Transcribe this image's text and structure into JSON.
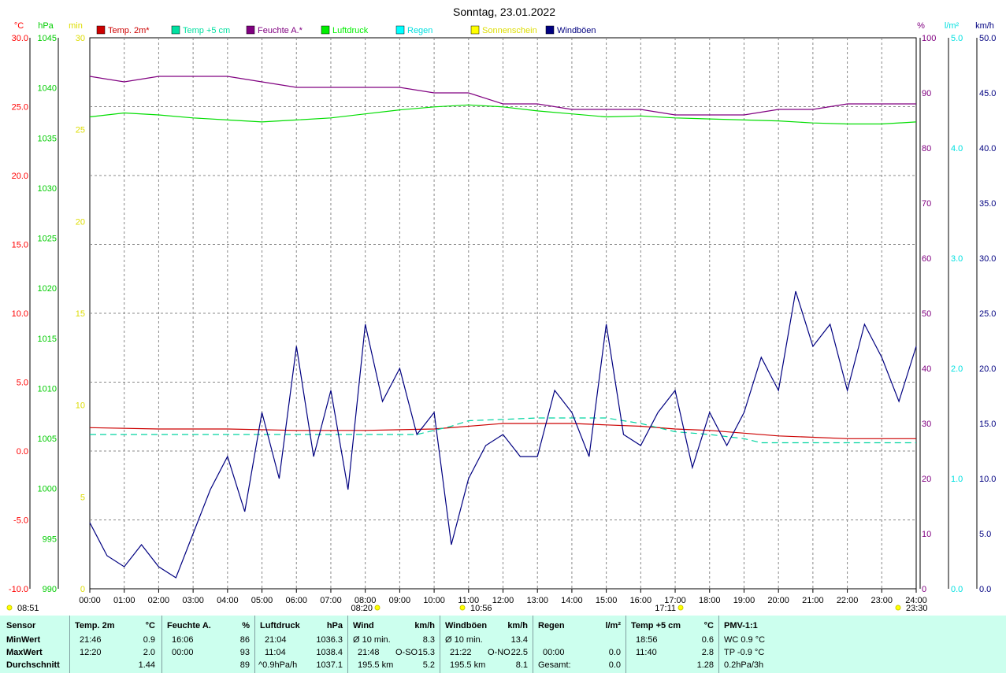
{
  "chart_data": {
    "type": "line",
    "title": "Sonntag, 23.01.2022",
    "x_ticks": [
      "00:00",
      "01:00",
      "02:00",
      "03:00",
      "04:00",
      "05:00",
      "06:00",
      "07:00",
      "08:00",
      "09:00",
      "10:00",
      "11:00",
      "12:00",
      "13:00",
      "14:00",
      "15:00",
      "16:00",
      "17:00",
      "18:00",
      "19:00",
      "20:00",
      "21:00",
      "22:00",
      "23:00",
      "24:00"
    ],
    "axes": {
      "temp": {
        "unit": "°C",
        "color": "#ff0000",
        "min": -10,
        "max": 30,
        "ticks": [
          "30.0",
          "25.0",
          "20.0",
          "15.0",
          "10.0",
          "5.0",
          "0.0",
          "-5.0",
          "-10.0"
        ]
      },
      "pressure": {
        "unit": "hPa",
        "color": "#00cc00",
        "min": 990,
        "max": 1045,
        "ticks": [
          "1045",
          "1040",
          "1035",
          "1030",
          "1025",
          "1020",
          "1015",
          "1010",
          "1005",
          "1000",
          "995",
          "990"
        ]
      },
      "sunshine": {
        "unit": "min",
        "color": "#ffff00",
        "min": 0,
        "max": 30,
        "ticks": [
          "30",
          "25",
          "20",
          "15",
          "10",
          "5",
          "0"
        ]
      },
      "humidity": {
        "unit": "%",
        "color": "#800080",
        "min": 0,
        "max": 100,
        "ticks": [
          "100",
          "90",
          "80",
          "70",
          "60",
          "50",
          "40",
          "30",
          "20",
          "10",
          "0"
        ]
      },
      "rain": {
        "unit": "l/m²",
        "color": "#00e0e0",
        "min": 0,
        "max": 5,
        "ticks": [
          "5.0",
          "4.0",
          "3.0",
          "2.0",
          "1.0",
          "0.0"
        ]
      },
      "wind": {
        "unit": "km/h",
        "color": "#000080",
        "min": 0,
        "max": 50,
        "ticks": [
          "50.0",
          "45.0",
          "40.0",
          "35.0",
          "30.0",
          "25.0",
          "20.0",
          "15.0",
          "10.0",
          "5.0",
          "0.0"
        ]
      }
    },
    "legend": [
      {
        "label": "Temp. 2m*",
        "color": "#cc0000"
      },
      {
        "label": "Temp +5 cm",
        "color": "#00e0a0"
      },
      {
        "label": "Feuchte A.*",
        "color": "#800080"
      },
      {
        "label": "Luftdruck",
        "color": "#00ee00"
      },
      {
        "label": "Regen",
        "color": "#00ffff"
      },
      {
        "label": "Sonnenschein",
        "color": "#ffff00"
      },
      {
        "label": "Windböen",
        "color": "#000080"
      }
    ],
    "series": [
      {
        "name": "Temp. 2m*",
        "axis": "temp",
        "x": [
          0,
          2,
          4,
          6,
          8,
          10,
          12,
          14,
          15,
          16,
          17,
          18,
          19,
          20,
          21,
          22,
          23,
          24
        ],
        "values": [
          1.7,
          1.6,
          1.6,
          1.5,
          1.5,
          1.6,
          2.0,
          2.0,
          1.9,
          1.8,
          1.6,
          1.5,
          1.3,
          1.1,
          1.0,
          0.9,
          0.9,
          0.9
        ]
      },
      {
        "name": "Temp +5 cm",
        "axis": "temp",
        "x": [
          0,
          8,
          9.5,
          10.5,
          11,
          12,
          13,
          15,
          16,
          17,
          18,
          19,
          19.5,
          24
        ],
        "values": [
          1.2,
          1.2,
          1.2,
          1.8,
          2.2,
          2.3,
          2.4,
          2.4,
          2.0,
          1.4,
          1.2,
          0.9,
          0.6,
          0.6
        ]
      },
      {
        "name": "Feuchte A.*",
        "axis": "humidity",
        "x": [
          0,
          1,
          2,
          3,
          4,
          5,
          6,
          7,
          8,
          9,
          10,
          11,
          12,
          13,
          14,
          15,
          16,
          17,
          18,
          19,
          20,
          21,
          22,
          23,
          24
        ],
        "values": [
          93,
          92,
          93,
          93,
          93,
          92,
          91,
          91,
          91,
          91,
          90,
          90,
          88,
          88,
          87,
          87,
          87,
          86,
          86,
          86,
          87,
          87,
          88,
          88,
          88
        ]
      },
      {
        "name": "Luftdruck",
        "axis": "pressure",
        "x": [
          0,
          1,
          2,
          3,
          4,
          5,
          6,
          7,
          8,
          9,
          10,
          11,
          12,
          13,
          14,
          15,
          16,
          17,
          18,
          19,
          20,
          21,
          22,
          23,
          24
        ],
        "values": [
          1037.1,
          1037.5,
          1037.3,
          1037.0,
          1036.8,
          1036.6,
          1036.8,
          1037.0,
          1037.4,
          1037.8,
          1038.1,
          1038.3,
          1038.1,
          1037.7,
          1037.4,
          1037.1,
          1037.2,
          1037.0,
          1036.9,
          1036.8,
          1036.7,
          1036.5,
          1036.4,
          1036.4,
          1036.6
        ]
      },
      {
        "name": "Windböen",
        "axis": "wind",
        "x": [
          0,
          0.5,
          1,
          1.5,
          2,
          2.5,
          3,
          3.5,
          4,
          4.5,
          5,
          5.5,
          6,
          6.5,
          7,
          7.5,
          8,
          8.5,
          9,
          9.5,
          10,
          10.5,
          11,
          11.5,
          12,
          12.5,
          13,
          13.5,
          14,
          14.5,
          15,
          15.5,
          16,
          16.5,
          17,
          17.5,
          18,
          18.5,
          19,
          19.5,
          20,
          20.5,
          21,
          21.5,
          22,
          22.5,
          23,
          23.5,
          24
        ],
        "values": [
          6,
          3,
          2,
          4,
          2,
          1,
          5,
          9,
          12,
          7,
          16,
          10,
          22,
          12,
          18,
          9,
          24,
          17,
          20,
          14,
          16,
          4,
          10,
          13,
          14,
          12,
          12,
          18,
          16,
          12,
          24,
          14,
          13,
          16,
          18,
          11,
          16,
          13,
          16,
          21,
          18,
          27,
          22,
          24,
          18,
          24,
          21,
          17,
          22
        ]
      }
    ],
    "markers": [
      {
        "label": "08:51"
      },
      {
        "label": "08:20"
      },
      {
        "label": "10:56"
      },
      {
        "label": "17:11"
      },
      {
        "label": "23:30"
      }
    ]
  },
  "stats": {
    "sensor": {
      "header": "Sensor",
      "rows": [
        "MinWert",
        "MaxWert",
        "Durchschnitt"
      ]
    },
    "temp2m": {
      "header": "Temp. 2m",
      "unit": "°C",
      "rows": [
        [
          "21:46",
          "0.9"
        ],
        [
          "12:20",
          "2.0"
        ],
        [
          "",
          "1.44"
        ]
      ]
    },
    "feuchte": {
      "header": "Feuchte A.",
      "unit": "%",
      "rows": [
        [
          "16:06",
          "86"
        ],
        [
          "00:00",
          "93"
        ],
        [
          "",
          "89"
        ]
      ]
    },
    "luftdruck": {
      "header": "Luftdruck",
      "unit": "hPa",
      "rows": [
        [
          "21:04",
          "1036.3"
        ],
        [
          "11:04",
          "1038.4"
        ],
        [
          "^0.9hPa/h",
          "1037.1"
        ]
      ]
    },
    "wind": {
      "header": "Wind",
      "unit": "km/h",
      "rows": [
        [
          "Ø 10 min.",
          "",
          "8.3"
        ],
        [
          "21:48",
          "O-SO",
          "15.3"
        ],
        [
          "195.5 km",
          "",
          "5.2"
        ]
      ]
    },
    "windboeen": {
      "header": "Windböen",
      "unit": "km/h",
      "rows": [
        [
          "Ø 10 min.",
          "",
          "13.4"
        ],
        [
          "21:22",
          "O-NO",
          "22.5"
        ],
        [
          "195.5 km",
          "",
          "8.1"
        ]
      ]
    },
    "regen": {
      "header": "Regen",
      "unit": "l/m²",
      "rows": [
        [
          "",
          ""
        ],
        [
          "00:00",
          "0.0"
        ],
        [
          "Gesamt:",
          "0.0"
        ]
      ]
    },
    "temp5": {
      "header": "Temp +5 cm",
      "unit": "°C",
      "rows": [
        [
          "18:56",
          "0.6"
        ],
        [
          "11:40",
          "2.8"
        ],
        [
          "",
          "1.28"
        ]
      ]
    },
    "pmv": {
      "header": "PMV-1:1",
      "rows": [
        "WC 0.9 °C",
        "TP -0.9 °C",
        "0.2hPa/3h"
      ]
    }
  }
}
